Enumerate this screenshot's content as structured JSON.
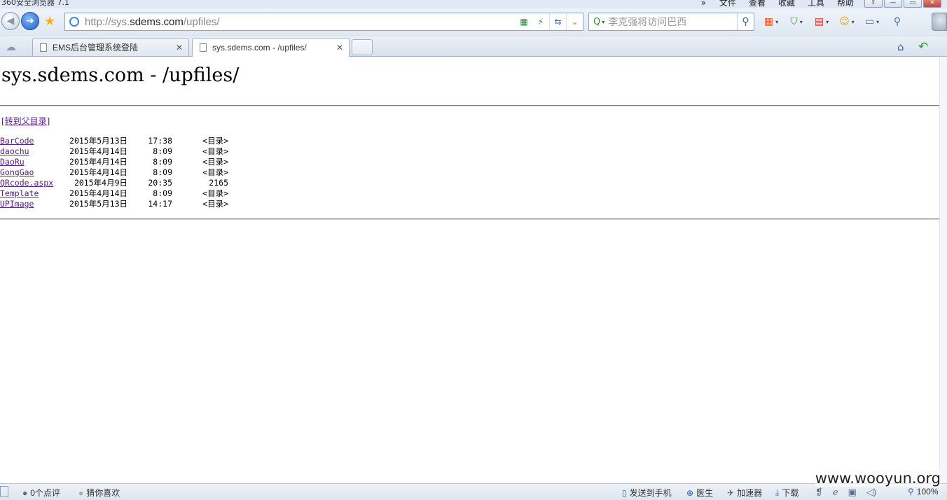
{
  "window": {
    "app_title": "360安全浏览器 7.1",
    "menu": {
      "more": "»",
      "items": [
        "文件",
        "查看",
        "收藏",
        "工具",
        "帮助"
      ]
    },
    "controls": {
      "shirt": "⇧",
      "minimize": "—",
      "maximize": "▭",
      "close": "✕"
    }
  },
  "nav": {
    "back_glyph": "◀",
    "forward_glyph": "➔",
    "favorite_glyph": "★",
    "address": {
      "url_prefix": "http://sys.",
      "url_domain": "sdems.com",
      "url_path": "/upfiles/"
    },
    "addr_tools": {
      "qr": "▦",
      "bolt": "⚡",
      "compat": "⇆",
      "drop": "⌄"
    },
    "search": {
      "engine_glyph": "Q",
      "caret": "▾",
      "placeholder": "李克强将访问巴西",
      "go_glyph": "⚲"
    },
    "extensions": {
      "apps": "▦",
      "shield": "⛉",
      "pdf": "▤",
      "face": "☺",
      "gallery": "▭",
      "zoom": "⚲",
      "caret": "▾"
    }
  },
  "tabs": {
    "cloud_glyph": "☁",
    "items": [
      {
        "label": "EMS后台管理系统登陆",
        "close": "✕"
      },
      {
        "label": "sys.sdems.com - /upfiles/",
        "close": "✕"
      }
    ],
    "home_glyph": "⌂",
    "reply_glyph": "↶"
  },
  "page": {
    "title": "sys.sdems.com - /upfiles/",
    "parent_link": "[转到父目录]",
    "entries": [
      {
        "date": "2015年5月13日",
        "time": "17:38",
        "kind": "<目录>",
        "name": "BarCode"
      },
      {
        "date": "2015年4月14日",
        "time": "8:09",
        "kind": "<目录>",
        "name": "daochu"
      },
      {
        "date": "2015年4月14日",
        "time": "8:09",
        "kind": "<目录>",
        "name": "DaoRu"
      },
      {
        "date": "2015年4月14日",
        "time": "8:09",
        "kind": "<目录>",
        "name": "GongGao"
      },
      {
        "date": "2015年4月9日",
        "time": "20:35",
        "kind": "2165",
        "name": "QRcode.aspx"
      },
      {
        "date": "2015年4月14日",
        "time": "8:09",
        "kind": "<目录>",
        "name": "Template"
      },
      {
        "date": "2015年5月13日",
        "time": "14:17",
        "kind": "<目录>",
        "name": "UPImage"
      }
    ]
  },
  "status": {
    "comments": "0个点评",
    "guess": "猜你喜欢",
    "send_phone": "发送到手机",
    "doctor": "医生",
    "accelerator": "加速器",
    "download": "下载",
    "zoom": "100%",
    "glyphs": {
      "comments": "●",
      "guess": "●",
      "phone": "▯",
      "doctor": "⊕",
      "accel": "✈",
      "download": "⤓",
      "a": "❡",
      "b": "ℯ",
      "c": "▣",
      "d": "◁)"
    }
  },
  "watermark": "www.wooyun.org"
}
